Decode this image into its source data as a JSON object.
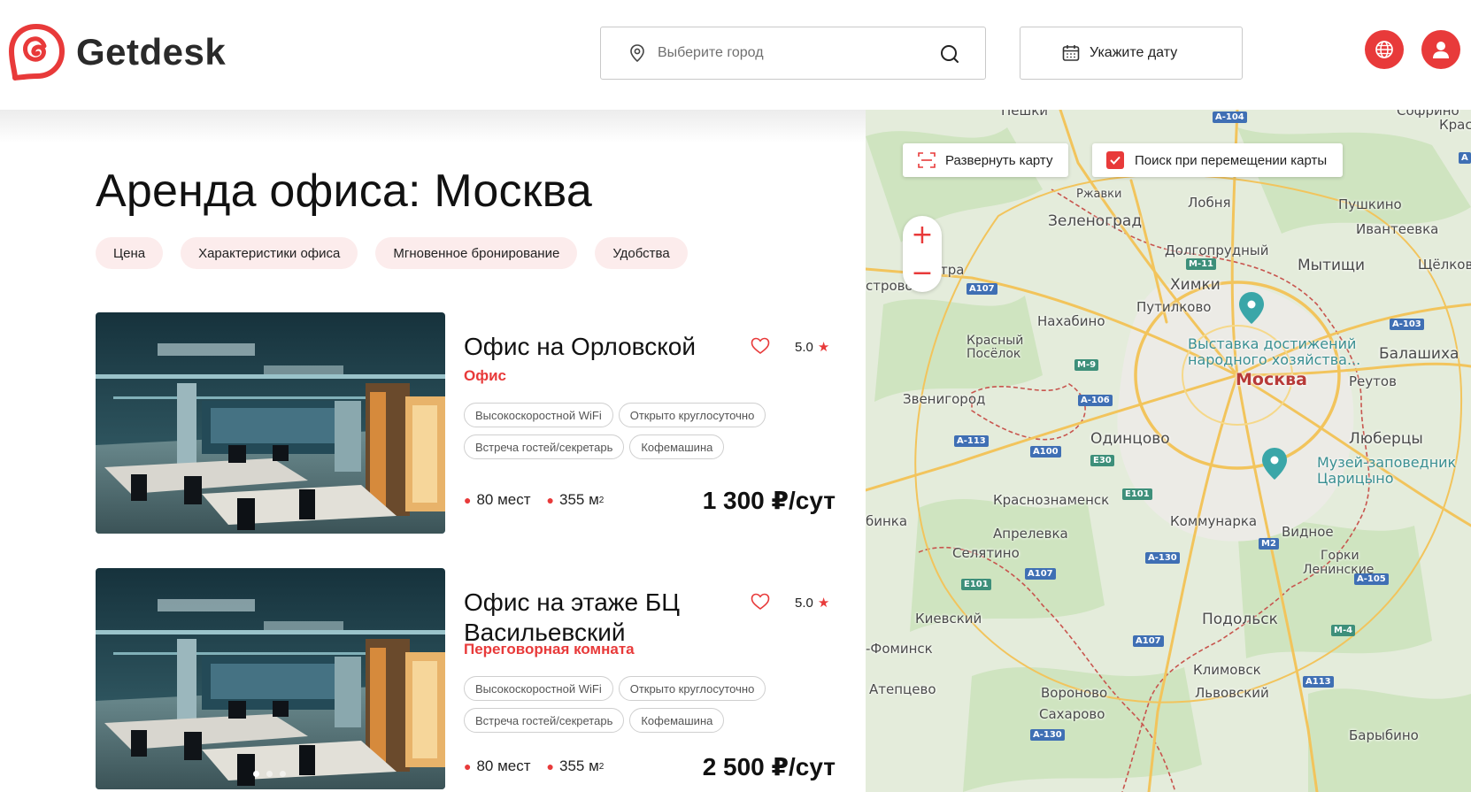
{
  "header": {
    "brand": "Getdesk",
    "city_placeholder": "Выберите город",
    "date_label": "Укажите дату"
  },
  "page": {
    "title": "Аренда офиса: Москва",
    "filters": [
      "Цена",
      "Характеристики офиса",
      "Мгновенное бронирование",
      "Удобства"
    ]
  },
  "listings": [
    {
      "title": "Офис на Орловской",
      "type": "Офис",
      "rating": "5.0",
      "tags": [
        [
          "Высокоскоростной WiFi",
          "Открыто круглосуточно"
        ],
        [
          "Встреча гостей/секретарь",
          "Кофемашина"
        ]
      ],
      "seats": "80 мест",
      "area": "355 м",
      "area_unit_sup": "2",
      "price": "1 300 ₽/сут"
    },
    {
      "title": "Офис на этаже БЦ Васильевский",
      "type": "Переговорная комната",
      "rating": "5.0",
      "tags": [
        [
          "Высокоскоростной WiFi",
          "Открыто круглосуточно"
        ],
        [
          "Встреча гостей/секретарь",
          "Кофемашина"
        ]
      ],
      "seats": "80 мест",
      "area": "355 м",
      "area_unit_sup": "2",
      "price": "2 500 ₽/сут"
    }
  ],
  "map": {
    "expand_label": "Развернуть карту",
    "search_on_move_label": "Поиск при перемещении карты",
    "search_on_move_checked": true,
    "zoom_in": "+",
    "zoom_out": "−",
    "places": {
      "peshki": "Пешки",
      "rzhavki": "Ржавки",
      "lobnya": "Лобня",
      "pushkino": "Пушкино",
      "kras": "Крас",
      "zelenograd": "Зеленоград",
      "ivanteevka": "Ивантеевка",
      "dolgoprudny": "Долгопрудный",
      "mytishchi": "Мытищи",
      "shchelkovo": "Щёлков",
      "tra": "тра",
      "strovo": "строво",
      "khimki": "Химки",
      "putilkovo": "Путилково",
      "nakhabino": "Нахабино",
      "krasny_posyolok": "Красный Посёлок",
      "vdnkh_1": "Выставка достижений",
      "vdnkh_2": "народного хозяйства...",
      "balashikha": "Балашиха",
      "reutov": "Реутов",
      "moskva": "Москва",
      "zvenigorod": "Звенигород",
      "odintsovo": "Одинцово",
      "lyubertsy": "Люберцы",
      "tsaritsyno_1": "Музей-заповедник",
      "tsaritsyno_2": "Царицыно",
      "krasnoznamensk": "Краснознаменск",
      "binka": "бинка",
      "kommunarka": "Коммунарка",
      "aprelevka": "Апрелевка",
      "vidnoe": "Видное",
      "selyatino": "Селятино",
      "gorki_1": "Горки",
      "gorki_2": "Ленинские",
      "kievsky": "Киевский",
      "podolsk": "Подольск",
      "fominsk": "-Фоминск",
      "klimovsk": "Климовск",
      "atepcevo": "Атепцево",
      "vorobovo": "Вороново",
      "lvovsky": "Львовский",
      "sakharovo": "Сахарово",
      "barybino": "Барыбино",
      "sofrino": "Софрино"
    },
    "roads": {
      "a104": "A-104",
      "m11": "M-11",
      "a107a": "A107",
      "a103": "A-103",
      "m9": "M-9",
      "a106": "A-106",
      "a113a": "A-113",
      "a100": "A100",
      "e30": "E30",
      "e101a": "E101",
      "m2": "M2",
      "a130a": "A-130",
      "a107b": "A107",
      "e101b": "E101",
      "a105": "A-105",
      "m4": "M-4",
      "a107c": "A107",
      "a113b": "A113",
      "a130b": "A-130",
      "a": "A"
    }
  }
}
